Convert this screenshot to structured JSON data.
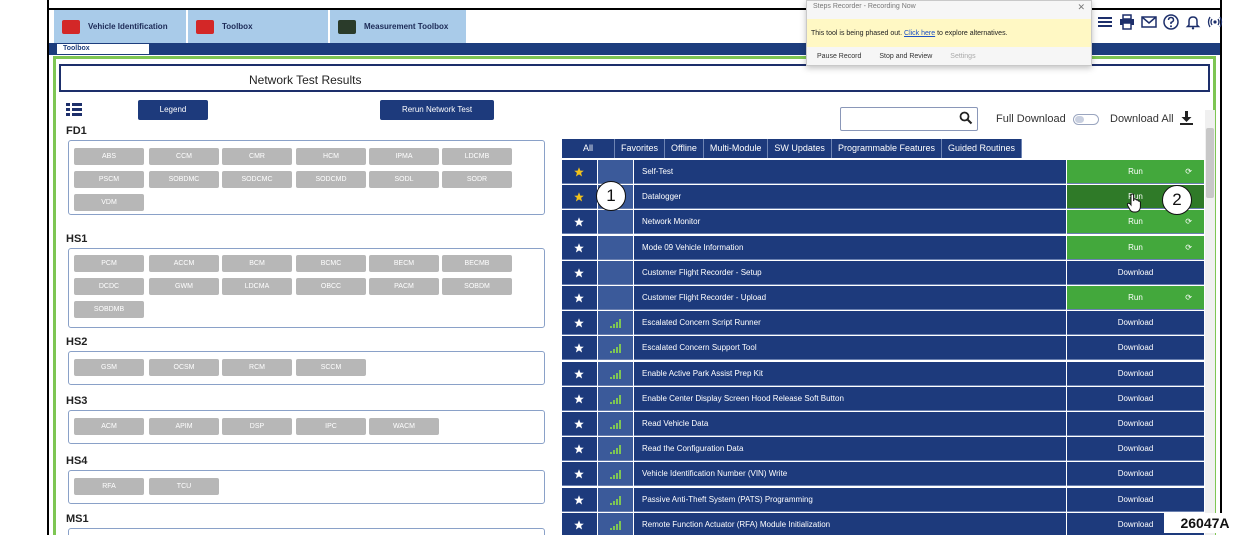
{
  "app_tabs": [
    {
      "label": "Vehicle Identification"
    },
    {
      "label": "Toolbox"
    },
    {
      "label": "Measurement Toolbox"
    }
  ],
  "sub_tab": "Toolbox",
  "popup": {
    "title": "Steps Recorder - Recording Now",
    "message_pre": "This tool is being phased out. ",
    "message_link": "Click here",
    "message_post": " to explore alternatives.",
    "actions": [
      "Pause Record",
      "Stop and Review",
      "Settings"
    ]
  },
  "page_title": "Network Test Results",
  "buttons": {
    "legend": "Legend",
    "rerun": "Rerun Network Test"
  },
  "networks": [
    {
      "name": "FD1",
      "modules": [
        "ABS",
        "CCM",
        "CMR",
        "HCM",
        "IPMA",
        "LDCMB",
        "PSCM",
        "SOBDMC",
        "SODCMC",
        "SODCMD",
        "SODL",
        "SODR",
        "VDM"
      ]
    },
    {
      "name": "HS1",
      "modules": [
        "PCM",
        "ACCM",
        "BCM",
        "BCMC",
        "BECM",
        "BECMB",
        "DCDC",
        "GWM",
        "LDCMA",
        "OBCC",
        "PACM",
        "SOBDM",
        "SOBDMB"
      ]
    },
    {
      "name": "HS2",
      "modules": [
        "GSM",
        "OCSM",
        "RCM",
        "SCCM"
      ]
    },
    {
      "name": "HS3",
      "modules": [
        "ACM",
        "APIM",
        "DSP",
        "IPC",
        "WACM"
      ]
    },
    {
      "name": "HS4",
      "modules": [
        "RFA",
        "TCU"
      ]
    },
    {
      "name": "MS1",
      "modules": []
    }
  ],
  "search": {
    "placeholder": ""
  },
  "full_download_label": "Full Download",
  "download_all_label": "Download All",
  "filter_tabs": [
    "All",
    "Favorites",
    "Offline",
    "Multi-Module",
    "SW Updates",
    "Programmable Features",
    "Guided Routines"
  ],
  "routines": [
    {
      "name": "Self-Test",
      "action": "Run",
      "favorite": true,
      "signal": false,
      "sync": true
    },
    {
      "name": "Datalogger",
      "action": "Run",
      "favorite": true,
      "signal": false,
      "sync": false
    },
    {
      "name": "Network Monitor",
      "action": "Run",
      "favorite": false,
      "signal": false,
      "sync": true
    },
    {
      "name": "Mode 09 Vehicle Information",
      "action": "Run",
      "favorite": false,
      "signal": false,
      "sync": true
    },
    {
      "name": "Customer Flight Recorder - Setup",
      "action": "Download",
      "favorite": false,
      "signal": false,
      "sync": false
    },
    {
      "name": "Customer Flight Recorder - Upload",
      "action": "Run",
      "favorite": false,
      "signal": false,
      "sync": true
    },
    {
      "name": "Escalated Concern Script Runner",
      "action": "Download",
      "favorite": false,
      "signal": true,
      "sync": false
    },
    {
      "name": "Escalated Concern Support Tool",
      "action": "Download",
      "favorite": false,
      "signal": true,
      "sync": false
    },
    {
      "name": "Enable Active Park Assist Prep Kit",
      "action": "Download",
      "favorite": false,
      "signal": true,
      "sync": false
    },
    {
      "name": "Enable Center Display Screen Hood Release Soft Button",
      "action": "Download",
      "favorite": false,
      "signal": true,
      "sync": false
    },
    {
      "name": "Read Vehicle Data",
      "action": "Download",
      "favorite": false,
      "signal": true,
      "sync": false
    },
    {
      "name": "Read the Configuration Data",
      "action": "Download",
      "favorite": false,
      "signal": true,
      "sync": false
    },
    {
      "name": "Vehicle Identification Number (VIN) Write",
      "action": "Download",
      "favorite": false,
      "signal": true,
      "sync": false
    },
    {
      "name": "Passive Anti-Theft System (PATS) Programming",
      "action": "Download",
      "favorite": false,
      "signal": true,
      "sync": false
    },
    {
      "name": "Remote Function Actuator (RFA) Module Initialization",
      "action": "Download",
      "favorite": false,
      "signal": true,
      "sync": false
    }
  ],
  "callouts": [
    "1",
    "2"
  ],
  "figure_code": "26047A",
  "colors": {
    "navy": "#1d3a7c",
    "run_green": "#43a83c",
    "panel_green": "#7ec653",
    "module_gray": "#b7b7b7"
  },
  "icons": [
    "print-icon",
    "mail-icon",
    "help-icon",
    "bell-icon",
    "broadcast-icon",
    "menu-icon",
    "search-icon",
    "download-icon",
    "star-icon",
    "signal-icon",
    "sync-icon"
  ]
}
